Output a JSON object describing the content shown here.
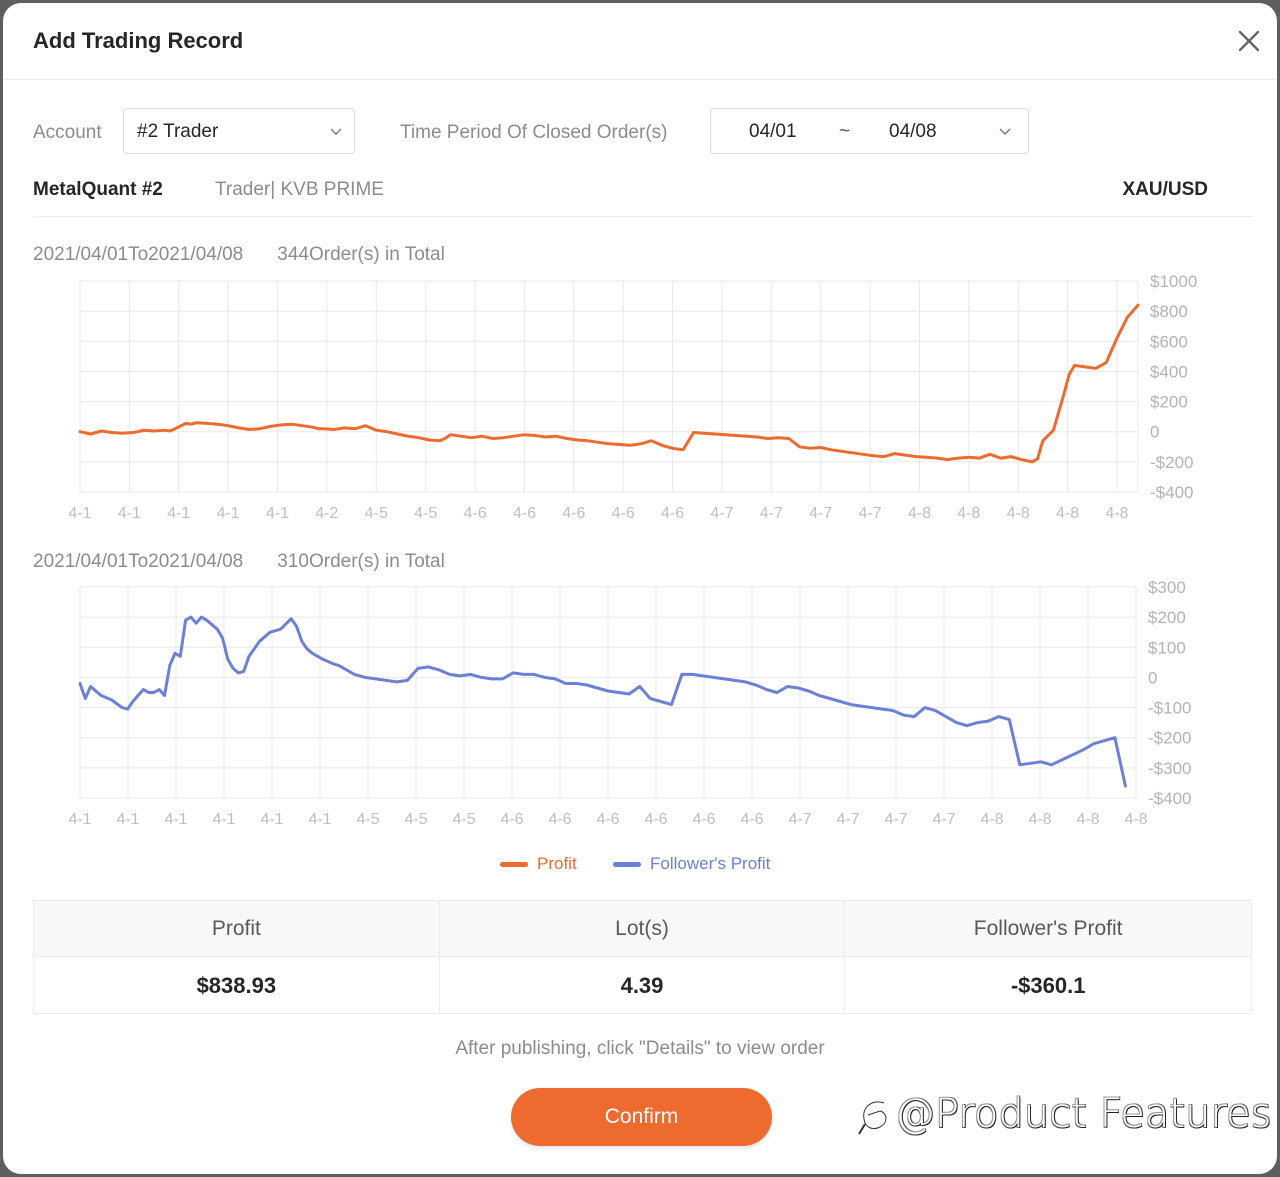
{
  "modal": {
    "title": "Add Trading Record",
    "close_icon": "close-icon"
  },
  "filters": {
    "account_label": "Account",
    "account_value": "#2 Trader",
    "period_label": "Time Period Of Closed Order(s)",
    "period_start": "04/01",
    "period_separator": "~",
    "period_end": "04/08"
  },
  "trader": {
    "name": "MetalQuant #2",
    "meta": "Trader| KVB PRIME",
    "symbol": "XAU/USD"
  },
  "colors": {
    "accent": "#ed6b2f",
    "profit_line": "#ed6b2f",
    "follower_line": "#6b80d6"
  },
  "chart_data": [
    {
      "type": "line",
      "title": "",
      "caption_range": "2021/04/01To2021/04/08",
      "caption_count": "344Order(s) in Total",
      "series": [
        {
          "name": "Profit",
          "color": "#ed6b2f",
          "x": [
            0,
            0.01,
            0.02,
            0.03,
            0.04,
            0.05,
            0.055,
            0.06,
            0.07,
            0.08,
            0.085,
            0.09,
            0.1,
            0.105,
            0.11,
            0.12,
            0.13,
            0.14,
            0.15,
            0.16,
            0.17,
            0.18,
            0.19,
            0.2,
            0.21,
            0.22,
            0.225,
            0.23,
            0.24,
            0.25,
            0.26,
            0.27,
            0.28,
            0.29,
            0.3,
            0.31,
            0.32,
            0.33,
            0.34,
            0.345,
            0.35,
            0.36,
            0.37,
            0.38,
            0.39,
            0.4,
            0.41,
            0.42,
            0.43,
            0.44,
            0.45,
            0.46,
            0.47,
            0.48,
            0.49,
            0.5,
            0.51,
            0.52,
            0.53,
            0.54,
            0.55,
            0.56,
            0.57,
            0.58,
            0.59,
            0.6,
            0.61,
            0.62,
            0.63,
            0.64,
            0.65,
            0.66,
            0.67,
            0.68,
            0.69,
            0.7,
            0.71,
            0.72,
            0.73,
            0.74,
            0.75,
            0.76,
            0.77,
            0.78,
            0.79,
            0.8,
            0.81,
            0.82,
            0.83,
            0.84,
            0.85,
            0.86,
            0.87,
            0.88,
            0.89,
            0.9,
            0.905,
            0.91,
            0.92,
            0.93,
            0.935,
            0.94,
            0.95,
            0.96,
            0.97,
            0.98,
            0.99,
            1.0
          ],
          "values": [
            0,
            -15,
            5,
            -5,
            -10,
            -5,
            0,
            10,
            5,
            10,
            5,
            20,
            55,
            50,
            60,
            55,
            50,
            40,
            25,
            15,
            20,
            35,
            45,
            50,
            40,
            30,
            20,
            20,
            15,
            25,
            20,
            40,
            10,
            0,
            -15,
            -30,
            -40,
            -55,
            -60,
            -45,
            -20,
            -30,
            -40,
            -30,
            -45,
            -40,
            -30,
            -20,
            -25,
            -35,
            -30,
            -45,
            -55,
            -60,
            -70,
            -80,
            -85,
            -90,
            -80,
            -60,
            -90,
            -110,
            -120,
            -5,
            -10,
            -15,
            -20,
            -25,
            -30,
            -35,
            -45,
            -40,
            -45,
            -100,
            -110,
            -105,
            -120,
            -130,
            -140,
            -150,
            -160,
            -165,
            -145,
            -155,
            -165,
            -170,
            -175,
            -185,
            -175,
            -170,
            -175,
            -150,
            -175,
            -165,
            -185,
            -200,
            -180,
            -60,
            10,
            250,
            380,
            440,
            430,
            420,
            460,
            620,
            760,
            840,
            838.93
          ],
          "x_tick_labels": [
            "4-1",
            "4-1",
            "4-1",
            "4-1",
            "4-1",
            "4-2",
            "4-5",
            "4-5",
            "4-6",
            "4-6",
            "4-6",
            "4-6",
            "4-6",
            "4-7",
            "4-7",
            "4-7",
            "4-7",
            "4-8",
            "4-8",
            "4-8",
            "4-8",
            "4-8"
          ]
        }
      ],
      "y_tick_labels": [
        "$1000",
        "$800",
        "$600",
        "$400",
        "$200",
        "0",
        "-$200",
        "-$400"
      ],
      "ylim": [
        -400,
        1000
      ],
      "grid": true
    },
    {
      "type": "line",
      "title": "",
      "caption_range": "2021/04/01To2021/04/08",
      "caption_count": "310Order(s) in Total",
      "series": [
        {
          "name": "Follower's Profit",
          "color": "#6b80d6",
          "x": [
            0,
            0.005,
            0.01,
            0.015,
            0.02,
            0.03,
            0.04,
            0.045,
            0.05,
            0.055,
            0.06,
            0.065,
            0.07,
            0.075,
            0.08,
            0.085,
            0.09,
            0.095,
            0.1,
            0.105,
            0.11,
            0.115,
            0.12,
            0.125,
            0.13,
            0.135,
            0.14,
            0.145,
            0.15,
            0.155,
            0.16,
            0.17,
            0.18,
            0.19,
            0.2,
            0.205,
            0.21,
            0.215,
            0.22,
            0.23,
            0.24,
            0.245,
            0.25,
            0.255,
            0.26,
            0.27,
            0.28,
            0.29,
            0.3,
            0.31,
            0.32,
            0.33,
            0.34,
            0.35,
            0.36,
            0.37,
            0.38,
            0.39,
            0.4,
            0.41,
            0.42,
            0.43,
            0.44,
            0.45,
            0.46,
            0.47,
            0.48,
            0.49,
            0.5,
            0.51,
            0.52,
            0.53,
            0.54,
            0.55,
            0.56,
            0.57,
            0.58,
            0.59,
            0.6,
            0.61,
            0.62,
            0.63,
            0.64,
            0.65,
            0.66,
            0.67,
            0.68,
            0.69,
            0.7,
            0.71,
            0.72,
            0.73,
            0.74,
            0.75,
            0.76,
            0.77,
            0.78,
            0.79,
            0.8,
            0.81,
            0.82,
            0.83,
            0.84,
            0.85,
            0.86,
            0.87,
            0.88,
            0.89,
            0.9,
            0.91,
            0.92,
            0.95,
            0.96,
            0.97,
            0.98,
            0.99,
            0.995,
            1.0
          ],
          "values": [
            -20,
            -70,
            -30,
            -45,
            -60,
            -75,
            -100,
            -105,
            -80,
            -60,
            -40,
            -50,
            -50,
            -40,
            -60,
            40,
            80,
            70,
            190,
            200,
            180,
            200,
            190,
            175,
            160,
            130,
            60,
            30,
            15,
            20,
            70,
            120,
            150,
            160,
            195,
            170,
            120,
            95,
            80,
            60,
            45,
            40,
            30,
            20,
            10,
            0,
            -5,
            -10,
            -15,
            -10,
            30,
            35,
            25,
            10,
            5,
            10,
            0,
            -5,
            -5,
            15,
            10,
            10,
            0,
            -5,
            -20,
            -20,
            -25,
            -35,
            -45,
            -50,
            -55,
            -30,
            -70,
            -80,
            -90,
            10,
            10,
            5,
            0,
            -5,
            -10,
            -15,
            -25,
            -40,
            -50,
            -30,
            -35,
            -45,
            -60,
            -70,
            -80,
            -90,
            -95,
            -100,
            -105,
            -110,
            -125,
            -130,
            -100,
            -110,
            -130,
            -150,
            -160,
            -150,
            -145,
            -130,
            -140,
            -290,
            -285,
            -280,
            -290,
            -240,
            -220,
            -210,
            -200,
            -360.1
          ],
          "x_tick_labels": [
            "4-1",
            "4-1",
            "4-1",
            "4-1",
            "4-1",
            "4-1",
            "4-5",
            "4-5",
            "4-5",
            "4-6",
            "4-6",
            "4-6",
            "4-6",
            "4-6",
            "4-6",
            "4-7",
            "4-7",
            "4-7",
            "4-7",
            "4-8",
            "4-8",
            "4-8",
            "4-8"
          ]
        }
      ],
      "y_tick_labels": [
        "$300",
        "$200",
        "$100",
        "0",
        "-$100",
        "-$200",
        "-$300",
        "-$400"
      ],
      "ylim": [
        -400,
        300
      ],
      "grid": true
    }
  ],
  "legend": {
    "items": [
      {
        "label": "Profit",
        "color": "#ed6b2f"
      },
      {
        "label": "Follower's Profit",
        "color": "#6b80d6"
      }
    ],
    "placement": "bottom-center"
  },
  "stats": {
    "headers": [
      "Profit",
      "Lot(s)",
      "Follower's Profit"
    ],
    "values": [
      "$838.93",
      "4.39",
      "-$360.1"
    ]
  },
  "hint": "After publishing, click \"Details\" to view order",
  "confirm_label": "Confirm",
  "watermark": "@Product Features"
}
